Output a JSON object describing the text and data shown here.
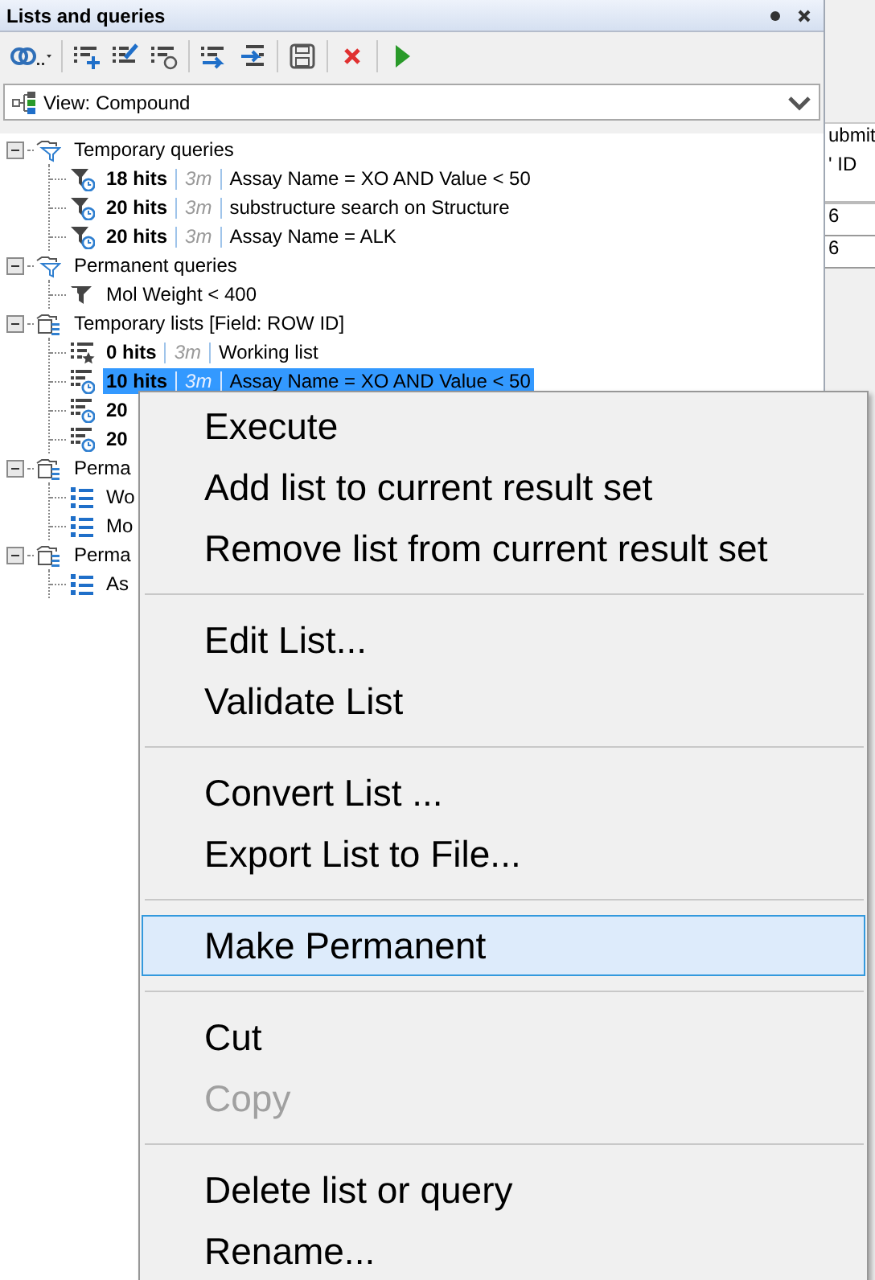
{
  "panel": {
    "title": "Lists and queries"
  },
  "view_selector": {
    "value": "View: Compound"
  },
  "tree": [
    {
      "kind": "query-group",
      "label": "Temporary queries",
      "expanded": true,
      "children": [
        {
          "kind": "query",
          "hits": "18 hits",
          "age": "3m",
          "label": "Assay Name = XO AND Value < 50",
          "selected": false
        },
        {
          "kind": "query",
          "hits": "20 hits",
          "age": "3m",
          "label": "substructure search on Structure",
          "selected": false
        },
        {
          "kind": "query",
          "hits": "20 hits",
          "age": "3m",
          "label": "Assay Name = ALK",
          "selected": false
        }
      ]
    },
    {
      "kind": "query-group",
      "label": "Permanent queries",
      "expanded": true,
      "children": [
        {
          "kind": "saved-query",
          "label": "Mol Weight < 400",
          "selected": false
        }
      ]
    },
    {
      "kind": "list-group",
      "label": "Temporary lists [Field: ROW ID]",
      "expanded": true,
      "children": [
        {
          "kind": "working-list",
          "hits": "0 hits",
          "age": "3m",
          "label": "Working list",
          "selected": false
        },
        {
          "kind": "temp-list",
          "hits": "10 hits",
          "age": "3m",
          "label": "Assay Name = XO AND Value < 50",
          "selected": true
        },
        {
          "kind": "temp-list",
          "hits": "20",
          "selected": false
        },
        {
          "kind": "temp-list",
          "hits": "20",
          "selected": false
        }
      ]
    },
    {
      "kind": "list-group",
      "label": "Perma",
      "expanded": true,
      "children": [
        {
          "kind": "list",
          "label": "Wo",
          "selected": false
        },
        {
          "kind": "list",
          "label": "Mo",
          "selected": false
        }
      ]
    },
    {
      "kind": "list-group",
      "label": "Perma",
      "expanded": true,
      "children": [
        {
          "kind": "list",
          "label": "As",
          "selected": false
        }
      ]
    }
  ],
  "background_table": {
    "column_header": "ubmit",
    "column_subheader": "' ID",
    "rows": [
      "6",
      "6"
    ]
  },
  "context_menu": {
    "items": [
      {
        "kind": "item",
        "label": "Execute",
        "selected": false,
        "disabled": false
      },
      {
        "kind": "item",
        "label": "Add list to current result set",
        "selected": false,
        "disabled": false
      },
      {
        "kind": "item",
        "label": "Remove list from current result set",
        "selected": false,
        "disabled": false
      },
      {
        "kind": "separator"
      },
      {
        "kind": "item",
        "label": "Edit List...",
        "selected": false,
        "disabled": false
      },
      {
        "kind": "item",
        "label": "Validate List",
        "selected": false,
        "disabled": false
      },
      {
        "kind": "separator"
      },
      {
        "kind": "item",
        "label": "Convert List ...",
        "selected": false,
        "disabled": false
      },
      {
        "kind": "item",
        "label": "Export List to File...",
        "selected": false,
        "disabled": false
      },
      {
        "kind": "separator"
      },
      {
        "kind": "item",
        "label": "Make Permanent",
        "selected": true,
        "disabled": false
      },
      {
        "kind": "separator"
      },
      {
        "kind": "item",
        "label": "Cut",
        "selected": false,
        "disabled": false
      },
      {
        "kind": "item",
        "label": "Copy",
        "selected": false,
        "disabled": true
      },
      {
        "kind": "separator"
      },
      {
        "kind": "item",
        "label": "Delete list or query",
        "selected": false,
        "disabled": false
      },
      {
        "kind": "item",
        "label": "Rename...",
        "selected": false,
        "disabled": false
      }
    ]
  }
}
